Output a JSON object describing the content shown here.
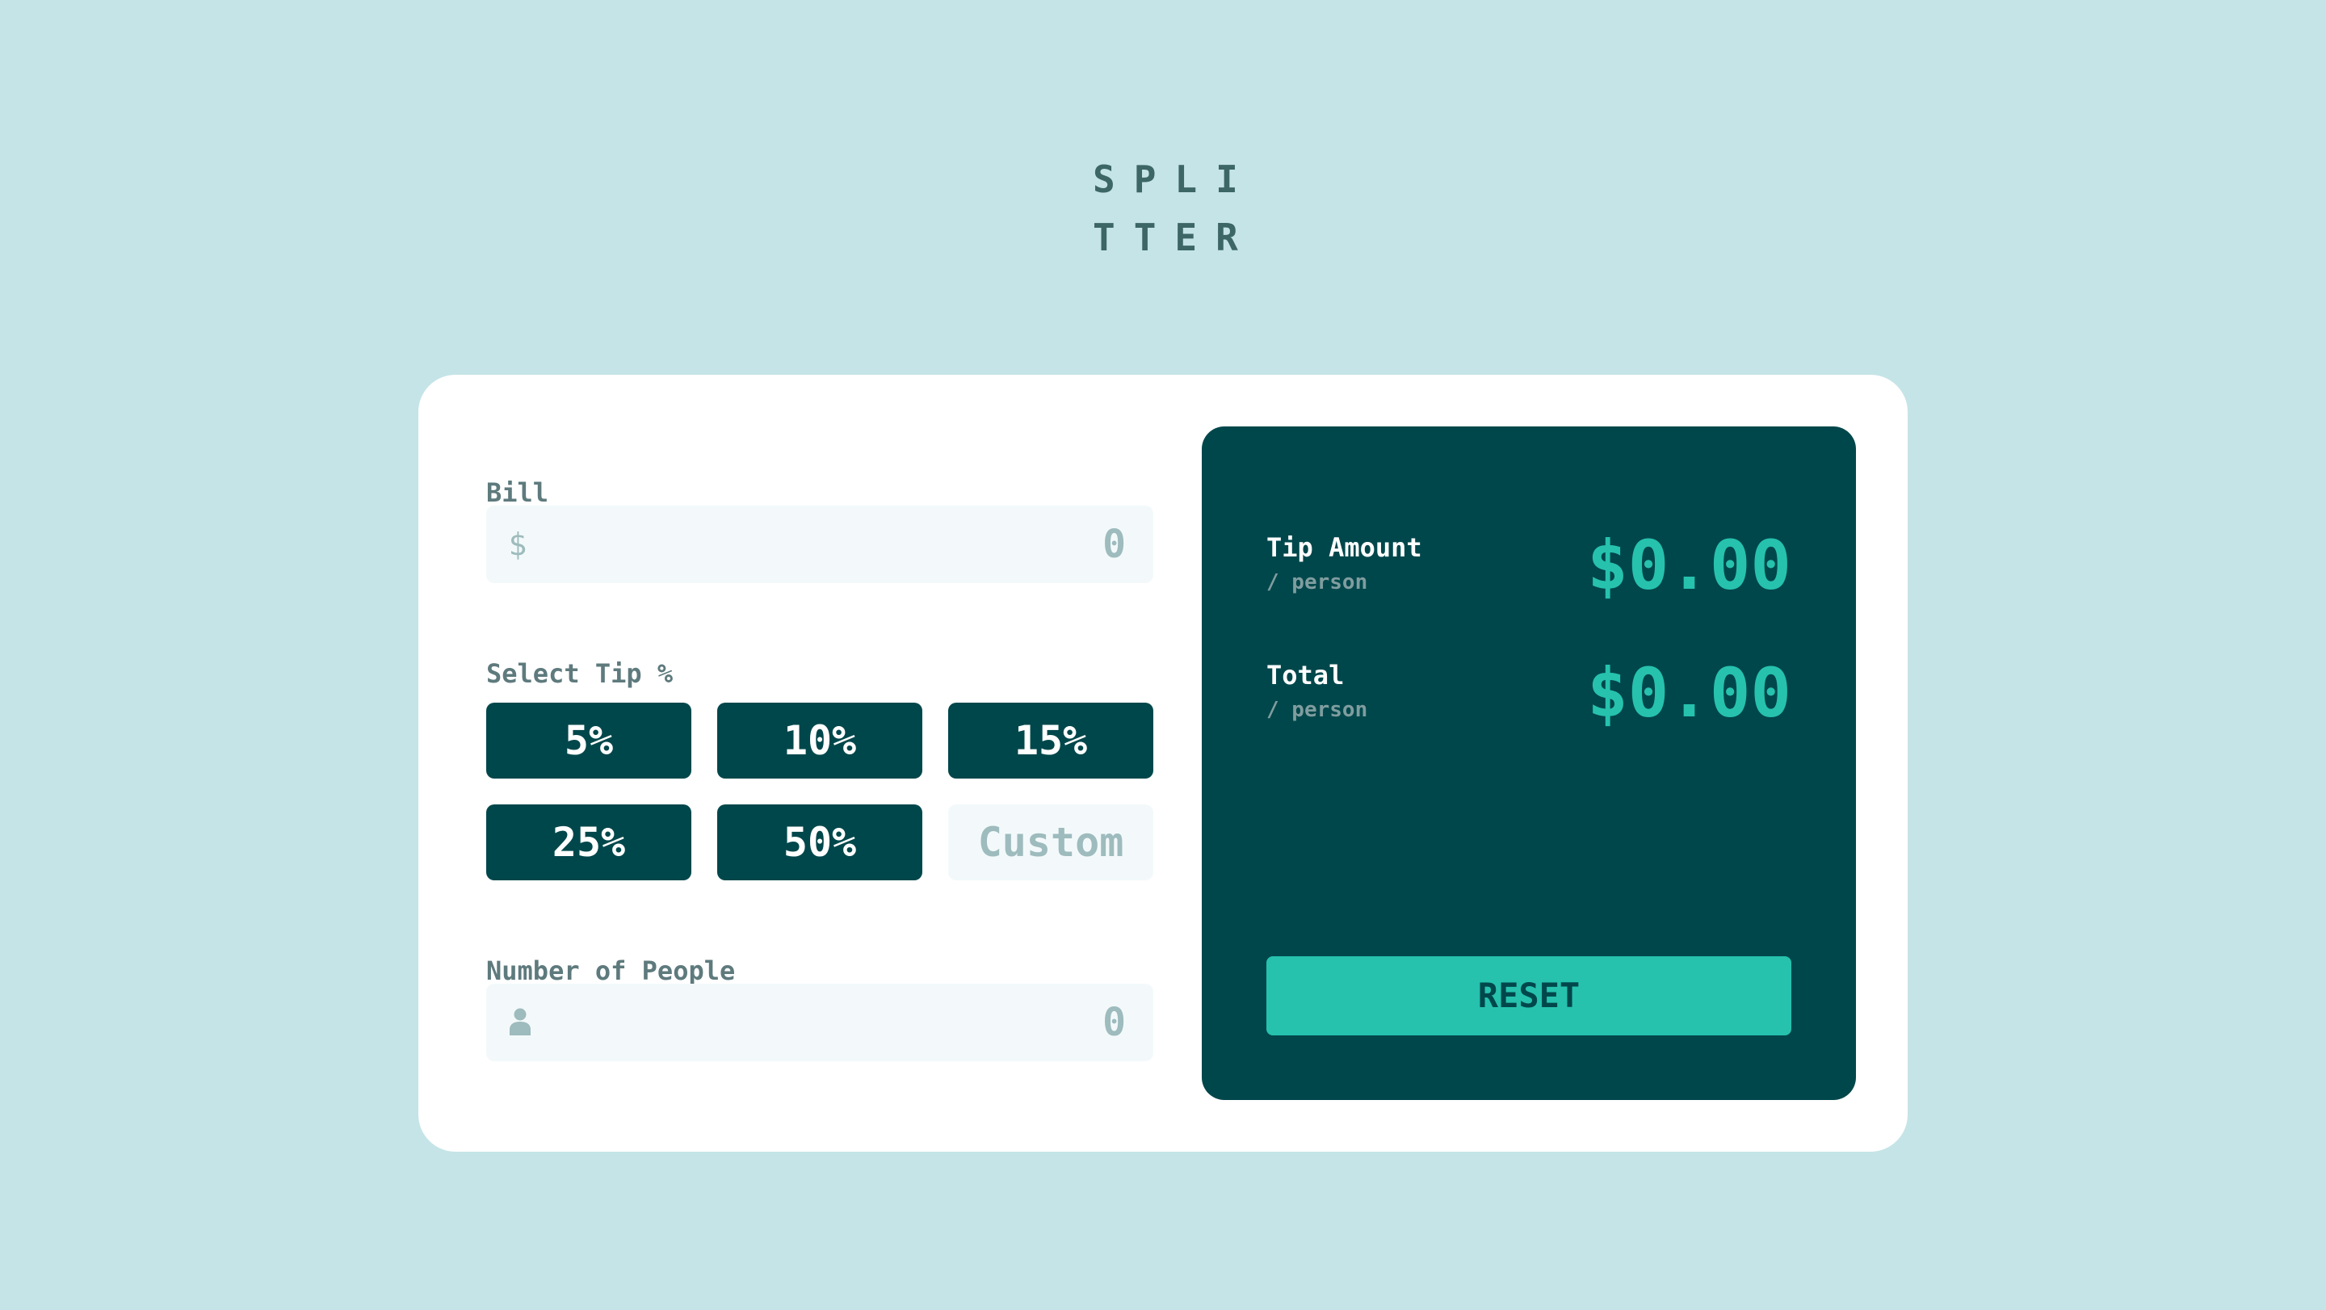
{
  "logo": {
    "line1": "SPLI",
    "line2": "TTER"
  },
  "bill": {
    "label": "Bill",
    "currency_symbol": "$",
    "value": "0"
  },
  "tip": {
    "label": "Select Tip %",
    "options": [
      "5%",
      "10%",
      "15%",
      "25%",
      "50%"
    ],
    "custom_placeholder": "Custom"
  },
  "people": {
    "label": "Number of People",
    "value": "0",
    "icon": "person-icon"
  },
  "results": {
    "tip_amount": {
      "title": "Tip Amount",
      "sub": "/ person",
      "value": "$0.00"
    },
    "total": {
      "title": "Total",
      "sub": "/ person",
      "value": "$0.00"
    }
  },
  "reset_label": "RESET",
  "colors": {
    "background": "#c5e4e7",
    "dark_cyan": "#00474b",
    "accent": "#26c2ae",
    "input_bg": "#f3f9fa",
    "muted": "#9ebbbd"
  }
}
